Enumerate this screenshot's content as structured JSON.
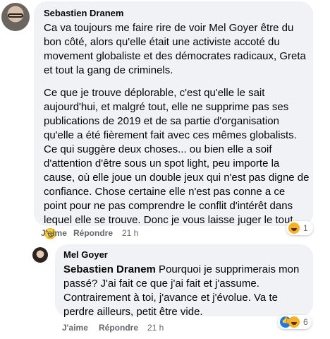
{
  "comment": {
    "author": "Sebastien Dranem",
    "para1": "Ca va toujours me faire rire de voir Mel Goyer être du bon côté, alors qu'elle était une activiste accoté du movement globaliste et des démocrates radicaux, Greta et tout la gang de criminels.",
    "para2": "Ce que je trouve déplorable, c'est qu'elle le sait aujourd'hui, et malgré tout, elle ne supprime pas ses publications de 2019 et de sa partie d'organisation qu'elle a été fièrement fait avec ces mêmes globalists. Ce qui suggère deux choses... ou bien elle a soif d'attention d'être sous un spot light, peu importe la cause, où elle joue un double jeux qui n'est pas digne de confiance. Chose certaine elle n'est pas conne a ce point pour ne pas comprendre le conflit d'intérêt dans lequel elle se trouve. Donc je vous laisse juger le tout. 😏",
    "like_label": "J'aime",
    "reply_label": "Répondre",
    "time": "21 h",
    "reaction_count": "1",
    "reaction_icon": "haha-emoji"
  },
  "reply": {
    "author": "Mel Goyer",
    "mention": "Sebastien Dranem",
    "text": " Pourquoi je supprimerais mon passé? J'ai fait ce que j'ai fait et j'assume. Contrairement à toi, j'avance et j'évolue. Va te perdre ailleurs, petit être vide.",
    "like_label": "J'aime",
    "reply_label": "Répondre",
    "time": "21 h",
    "reaction_count": "6",
    "reaction_icons": [
      "like-icon",
      "care-emoji"
    ]
  }
}
